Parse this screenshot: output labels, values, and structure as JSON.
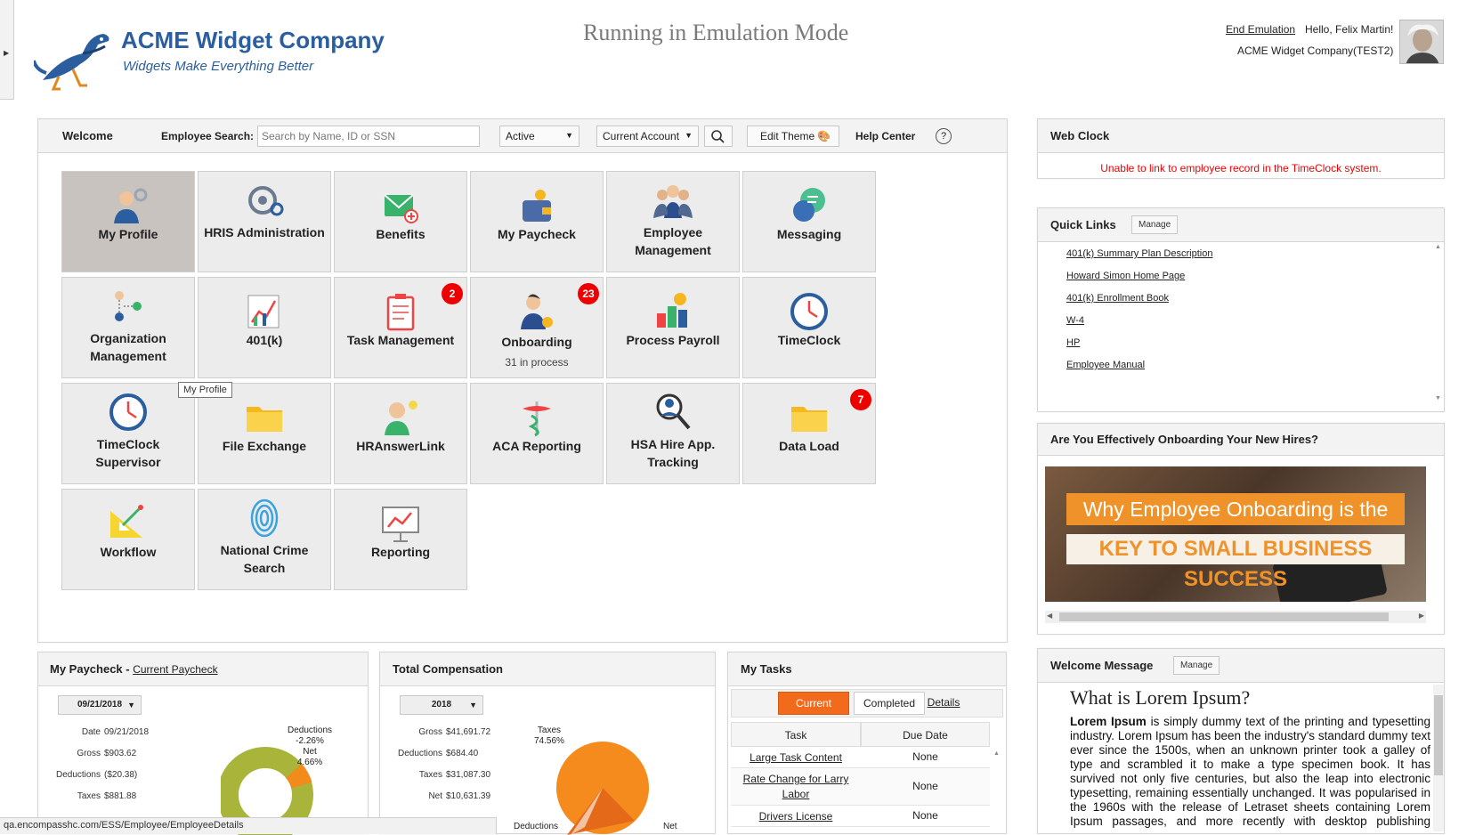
{
  "header": {
    "company_name": "ACME Widget Company",
    "company_tagline": "Widgets Make Everything Better",
    "emulation_banner": "Running in Emulation Mode",
    "end_emulation": "End Emulation",
    "greeting": "Hello, Felix Martin!",
    "account": "ACME Widget Company(TEST2)"
  },
  "toolbar": {
    "welcome": "Welcome",
    "employee_search_label": "Employee Search:",
    "employee_search_placeholder": "Search by Name, ID or SSN",
    "status_filter": "Active",
    "account_filter": "Current Account",
    "edit_theme": "Edit Theme",
    "help_center": "Help Center",
    "help_icon": "?"
  },
  "tiles": [
    {
      "label": "My Profile",
      "icon": "profile-icon"
    },
    {
      "label": "HRIS Administration",
      "icon": "hris-icon"
    },
    {
      "label": "Benefits",
      "icon": "benefits-icon"
    },
    {
      "label": "My Paycheck",
      "icon": "paycheck-icon"
    },
    {
      "label": "Employee Management",
      "icon": "employees-icon"
    },
    {
      "label": "Messaging",
      "icon": "messaging-icon"
    },
    {
      "label": "Organization Management",
      "icon": "org-icon"
    },
    {
      "label": "401(k)",
      "icon": "chart-icon"
    },
    {
      "label": "Task Management",
      "icon": "clipboard-icon",
      "badge": "2"
    },
    {
      "label": "Onboarding",
      "icon": "onboarding-icon",
      "badge": "23",
      "sub": "31 in process"
    },
    {
      "label": "Process Payroll",
      "icon": "payroll-icon"
    },
    {
      "label": "TimeClock",
      "icon": "clock-icon"
    },
    {
      "label": "TimeClock Supervisor",
      "icon": "clock-icon"
    },
    {
      "label": "File Exchange",
      "icon": "folder-icon"
    },
    {
      "label": "HRAnswerLink",
      "icon": "hr-answer-icon"
    },
    {
      "label": "ACA Reporting",
      "icon": "caduceus-icon"
    },
    {
      "label": "HSA Hire App. Tracking",
      "icon": "magnifier-icon"
    },
    {
      "label": "Data Load",
      "icon": "folder-icon",
      "badge": "7"
    },
    {
      "label": "Workflow",
      "icon": "workflow-icon"
    },
    {
      "label": "National Crime Search",
      "icon": "fingerprint-icon"
    },
    {
      "label": "Reporting",
      "icon": "presentation-icon"
    }
  ],
  "tooltip": "My Profile",
  "web_clock": {
    "title": "Web Clock",
    "message": "Unable to link to employee record in the TimeClock system."
  },
  "quick_links": {
    "title": "Quick Links",
    "manage": "Manage",
    "items": [
      "401(k) Summary Plan Description",
      "Howard Simon Home Page",
      "401(k) Enrollment Book",
      "W-4",
      "HP",
      "Employee Manual"
    ]
  },
  "onboarding_promo": {
    "title": "Are You Effectively Onboarding Your New Hires?",
    "line1": "Why Employee Onboarding is the",
    "line2": "KEY TO SMALL BUSINESS SUCCESS"
  },
  "welcome_message": {
    "title": "Welcome Message",
    "manage": "Manage",
    "heading": "What is Lorem Ipsum?",
    "lead": "Lorem Ipsum",
    "body": " is simply dummy text of the printing and typesetting industry. Lorem Ipsum has been the industry's standard dummy text ever since the 1500s, when an unknown printer took a galley of type and scrambled it to make a type specimen book. It has survived not only five centuries, but also the leap into electronic typesetting, remaining essentially unchanged. It was popularised in the 1960s with the release of Letraset sheets containing Lorem Ipsum passages, and more recently with desktop publishing software like Aldus PageMaker including versions of Lorem Ipsum."
  },
  "my_paycheck": {
    "title": "My Paycheck - ",
    "link": "Current Paycheck",
    "date_select": "09/21/2018",
    "rows": [
      {
        "k": "Date",
        "v": "09/21/2018"
      },
      {
        "k": "Gross",
        "v": "$903.62"
      },
      {
        "k": "Deductions",
        "v": "($20.38)"
      },
      {
        "k": "Taxes",
        "v": "$881.88"
      }
    ],
    "legend": [
      {
        "name": "Deductions",
        "pct": "-2.26%"
      },
      {
        "name": "Net",
        "pct": "4.66%"
      }
    ]
  },
  "total_comp": {
    "title": "Total Compensation",
    "year_select": "2018",
    "rows": [
      {
        "k": "Gross",
        "v": "$41,691.72"
      },
      {
        "k": "Deductions",
        "v": "$684.40"
      },
      {
        "k": "Taxes",
        "v": "$31,087.30"
      },
      {
        "k": "Net",
        "v": "$10,631.39"
      }
    ],
    "taxes_label": "Taxes",
    "taxes_pct": "74.56%",
    "deductions_label": "Deductions",
    "net_label": "Net"
  },
  "my_tasks": {
    "title": "My Tasks",
    "tab_current": "Current",
    "tab_completed": "Completed",
    "details": "Details",
    "col_task": "Task",
    "col_due": "Due Date",
    "rows": [
      {
        "task": "Large Task Content",
        "due": "None"
      },
      {
        "task": "Rate Change for Larry Labor",
        "due": "None"
      },
      {
        "task": "Drivers License",
        "due": "None"
      }
    ]
  },
  "status_bar": "qa.encompasshc.com/ESS/Employee/EmployeeDetails",
  "colors": {
    "accent": "#2b5e9e",
    "badge": "#ee0000",
    "task_tab": "#f26a1b",
    "error": "#ee0000"
  }
}
